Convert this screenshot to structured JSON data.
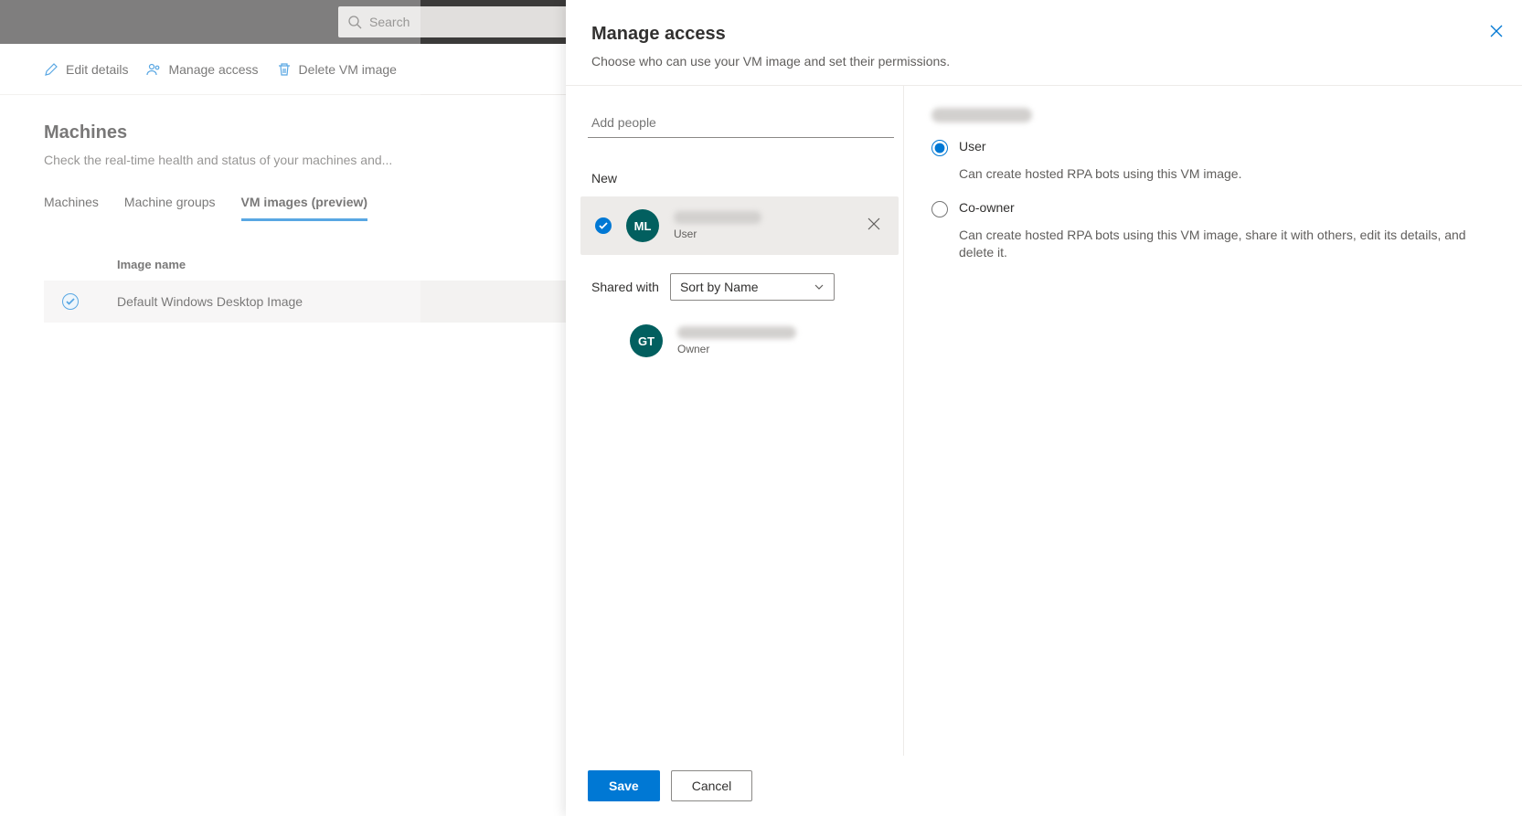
{
  "search": {
    "placeholder": "Search"
  },
  "commands": {
    "edit": "Edit details",
    "manage": "Manage access",
    "delete": "Delete VM image"
  },
  "page": {
    "title": "Machines",
    "subtitle": "Check the real-time health and status of your machines and..."
  },
  "tabs": {
    "machines": "Machines",
    "groups": "Machine groups",
    "images": "VM images (preview)"
  },
  "table": {
    "header_image_name": "Image name",
    "row1_name": "Default Windows Desktop Image"
  },
  "panel": {
    "title": "Manage access",
    "subtitle": "Choose who can use your VM image and set their permissions.",
    "add_people_placeholder": "Add people",
    "section_new": "New",
    "section_shared": "Shared with",
    "sort": "Sort by Name",
    "people": {
      "new_initials": "ML",
      "new_role": "User",
      "shared_initials": "GT",
      "shared_role": "Owner"
    },
    "perms": {
      "user_label": "User",
      "user_desc": "Can create hosted RPA bots using this VM image.",
      "coowner_label": "Co-owner",
      "coowner_desc": "Can create hosted RPA bots using this VM image, share it with others, edit its details, and delete it."
    },
    "save": "Save",
    "cancel": "Cancel"
  }
}
